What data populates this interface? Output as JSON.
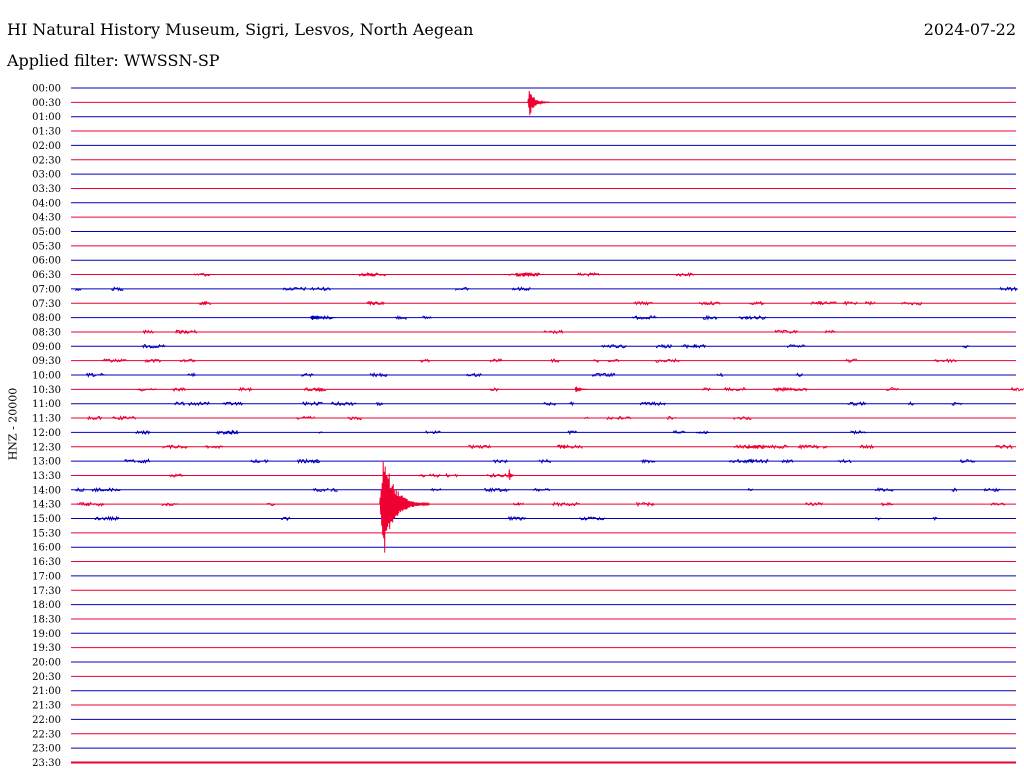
{
  "header": {
    "title": "HI Natural History Museum, Sigri, Lesvos, North Aegean",
    "date": "2024-07-22",
    "filter": "Applied filter: WWSSN-SP"
  },
  "channel_label": "HNZ - 20000",
  "colors": {
    "even": "#0000bb",
    "odd": "#ee0033",
    "background": "#ffffff"
  },
  "chart_data": {
    "type": "line",
    "title": "HI Natural History Museum, Sigri, Lesvos, North Aegean",
    "ylabel": "HNZ - 20000",
    "x": {
      "unit": "minutes into trace",
      "range": [
        0,
        30
      ]
    },
    "row_labels": [
      "00:00",
      "00:30",
      "01:00",
      "01:30",
      "02:00",
      "02:30",
      "03:00",
      "03:30",
      "04:00",
      "04:30",
      "05:00",
      "05:30",
      "06:00",
      "06:30",
      "07:00",
      "07:30",
      "08:00",
      "08:30",
      "09:00",
      "09:30",
      "10:00",
      "10:30",
      "11:00",
      "11:30",
      "12:00",
      "12:30",
      "13:00",
      "13:30",
      "14:00",
      "14:30",
      "15:00",
      "15:30",
      "16:00",
      "16:30",
      "17:00",
      "17:30",
      "18:00",
      "18:30",
      "19:00",
      "19:30",
      "20:00",
      "20:30",
      "21:00",
      "21:30",
      "22:00",
      "22:30",
      "23:00",
      "23:30"
    ],
    "row_colors": "alternating blue / red",
    "events": [
      {
        "row": "00:30",
        "minute": 14.5,
        "amplitude": 1.0,
        "duration_min": 0.7
      },
      {
        "row": "14:30",
        "minute": 9.8,
        "amplitude": 3.8,
        "duration_min": 1.6
      },
      {
        "row": "13:30",
        "minute": 13.9,
        "amplitude": 0.5,
        "duration_min": 0.2
      },
      {
        "row": "10:30",
        "minute": 16.0,
        "amplitude": 0.3,
        "duration_min": 0.4
      },
      {
        "row": "08:00",
        "minute": 7.6,
        "amplitude": 0.2,
        "duration_min": 0.8
      }
    ],
    "noisy_rows": [
      "06:30",
      "07:00",
      "07:30",
      "08:00",
      "08:30",
      "09:00",
      "09:30",
      "10:00",
      "10:30",
      "11:00",
      "11:30",
      "12:00",
      "12:30",
      "13:00",
      "13:30",
      "14:00",
      "14:30",
      "15:00"
    ]
  }
}
